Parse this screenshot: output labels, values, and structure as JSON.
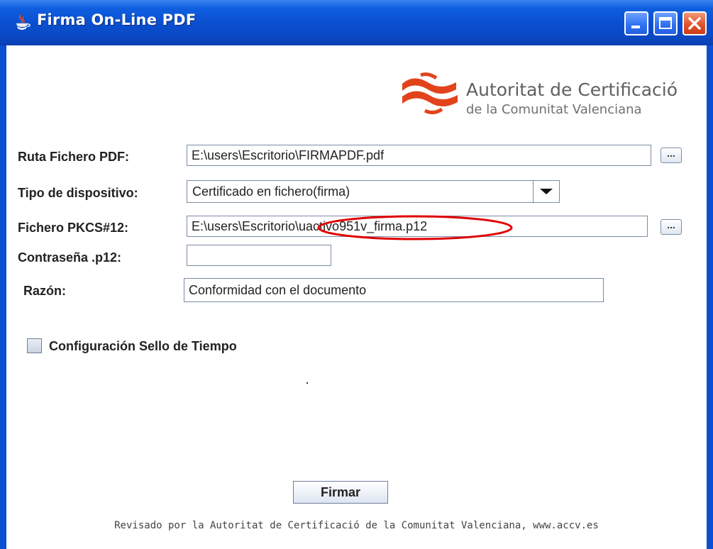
{
  "window": {
    "title": "Firma On-Line PDF"
  },
  "logo": {
    "line1": "Autoritat de Certificació",
    "line2": "de la Comunitat Valenciana",
    "color": "#e2431c"
  },
  "form": {
    "ruta": {
      "label": "Ruta Fichero PDF:",
      "value": "E:\\users\\Escritorio\\FIRMAPDF.pdf",
      "browse": "..."
    },
    "tipo": {
      "label": "Tipo de dispositivo:",
      "value": "Certificado en fichero(firma)"
    },
    "pkcs": {
      "label": "Fichero PKCS#12:",
      "value": "E:\\users\\Escritorio\\uactivo951v_firma.p12",
      "browse": "..."
    },
    "pass": {
      "label": "Contraseña .p12:",
      "value": ""
    },
    "razon": {
      "label": "Razón:",
      "value": "Conformidad con el documento"
    }
  },
  "sello": {
    "label": "Configuración Sello de Tiempo",
    "checked": false
  },
  "actions": {
    "firmar": "Firmar"
  },
  "footer": "Revisado por la Autoritat de Certificació de la Comunitat Valenciana, www.accv.es",
  "annotation_color": "#e00000"
}
